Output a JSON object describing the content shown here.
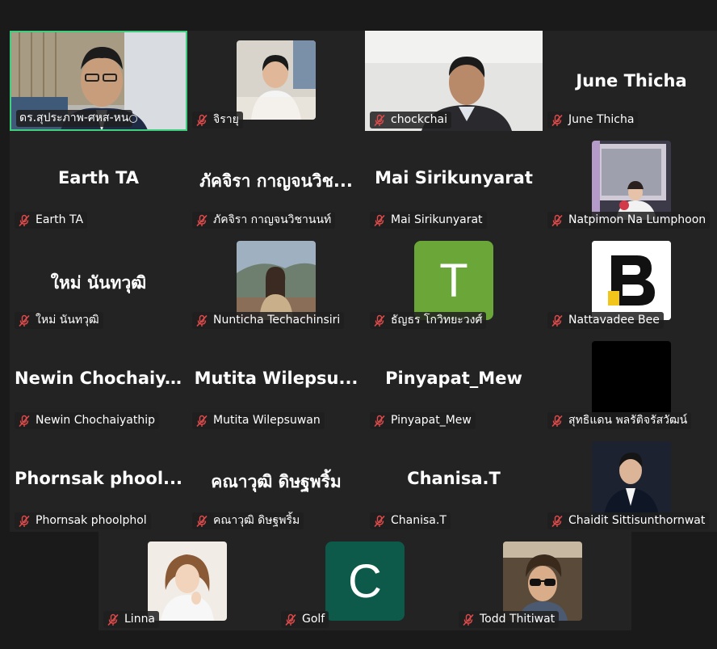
{
  "meeting": {
    "accent_active": "#3fcf7e",
    "participants": [
      {
        "name": "ดร.สุประภาพ-ศหส-หน",
        "type": "video"
      },
      {
        "name": "จิรายุ",
        "type": "photo"
      },
      {
        "name": "chockchai",
        "type": "video"
      },
      {
        "name": "June Thicha",
        "display": "June Thicha",
        "type": "name"
      },
      {
        "name": "Earth TA",
        "display": "Earth TA",
        "type": "name"
      },
      {
        "name": "ภัคจิรา กาญจนวิชานนท์",
        "display": "ภัคจิรา กาญจนวิช...",
        "type": "name"
      },
      {
        "name": "Mai Sirikunyarat",
        "display": "Mai Sirikunyarat",
        "type": "name"
      },
      {
        "name": "Natpimon Na Lumphoon",
        "type": "photo"
      },
      {
        "name": "ใหม่ นันทวุฒิ",
        "display": "ใหม่ นันทวุฒิ",
        "type": "name"
      },
      {
        "name": "Nunticha Techachinsiri",
        "type": "photo"
      },
      {
        "name": "ธัญธร โกวิทยะวงศ์",
        "type": "letter",
        "letter": "T",
        "color": "#6aa638"
      },
      {
        "name": "Nattavadee Bee",
        "type": "logo",
        "letter": "B"
      },
      {
        "name": "Newin Chochaiyathip",
        "display": "Newin  Chochaiy...",
        "type": "name"
      },
      {
        "name": "Mutita Wilepsuwan",
        "display": "Mutita  Wilepsu...",
        "type": "name"
      },
      {
        "name": "Pinyapat_Mew",
        "display": "Pinyapat_Mew",
        "type": "name"
      },
      {
        "name": "สุทธิแดน พลรัติจรัสวัฒน์",
        "type": "black"
      },
      {
        "name": "Phornsak phoolphol",
        "display": "Phornsak  phool...",
        "type": "name"
      },
      {
        "name": "คณาวุฒิ ดิษฐพริ้ม",
        "display": "คณาวุฒิ ดิษฐพริ้ม",
        "type": "name"
      },
      {
        "name": "Chanisa.T",
        "display": "Chanisa.T",
        "type": "name"
      },
      {
        "name": "Chaidit Sittisunthornwat",
        "type": "photo"
      },
      {
        "name": "Linna",
        "type": "photo"
      },
      {
        "name": "Golf",
        "type": "letter",
        "letter": "C",
        "color": "#0e5a4a"
      },
      {
        "name": "Todd Thitiwat",
        "type": "photo"
      }
    ]
  }
}
